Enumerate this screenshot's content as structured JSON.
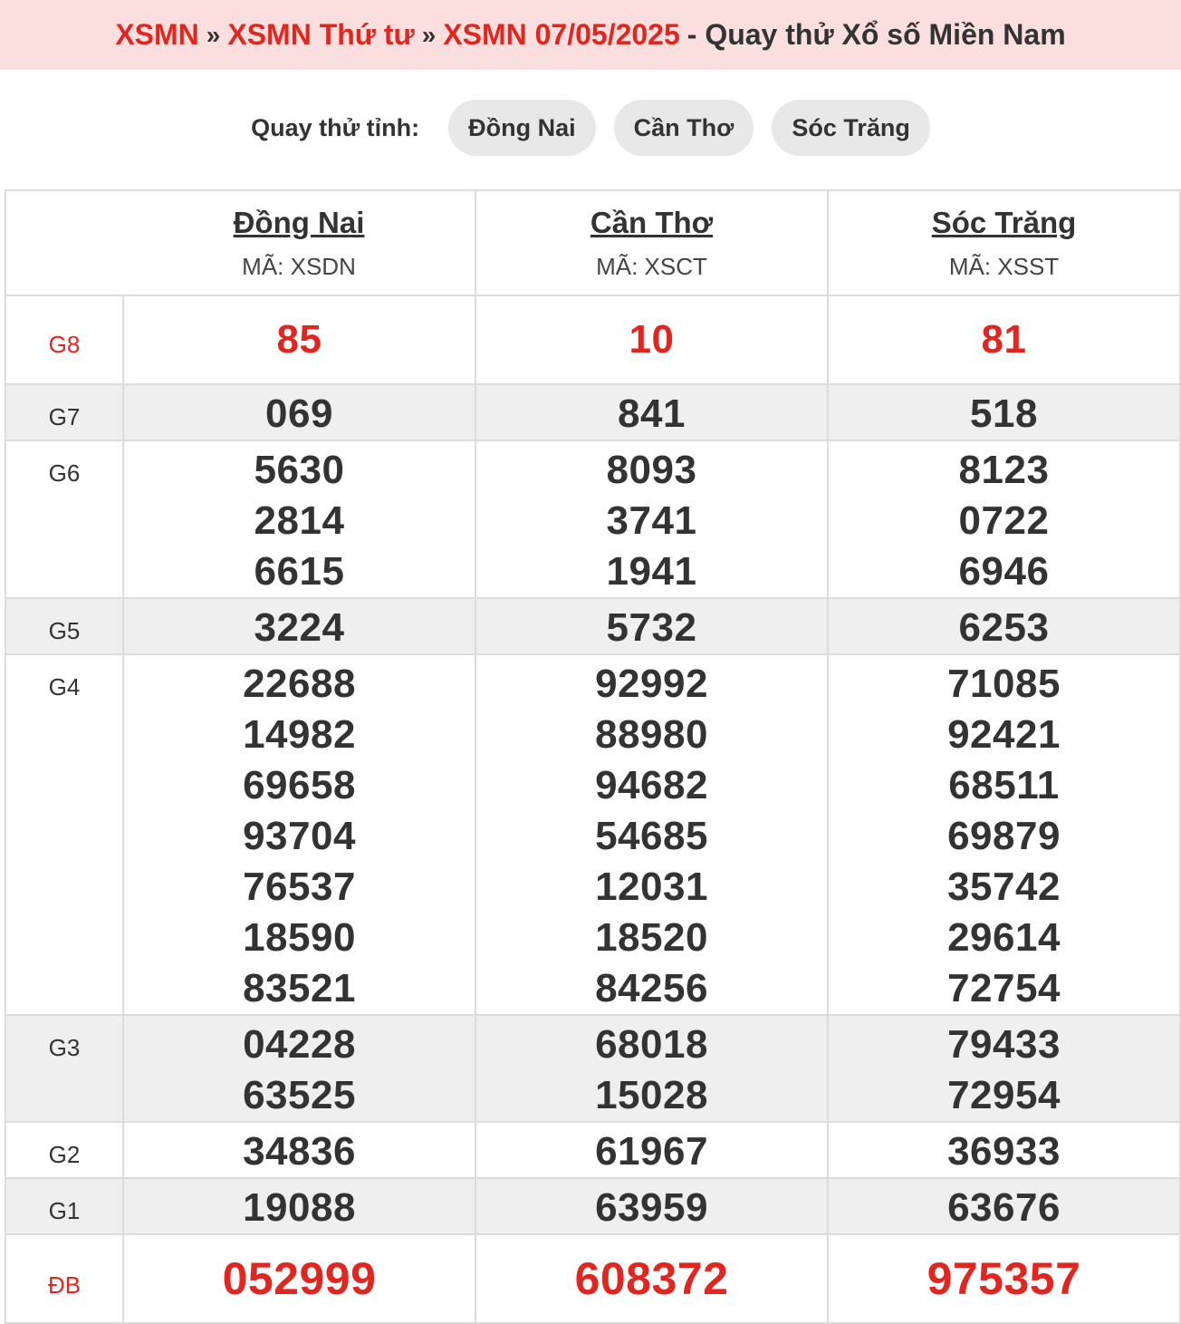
{
  "breadcrumb": {
    "items": [
      "XSMN",
      "XSMN Thứ tư",
      "XSMN 07/05/2025"
    ],
    "separator": "»",
    "suffix": "- Quay thử Xổ số Miền Nam"
  },
  "quick": {
    "label": "Quay thử tỉnh:",
    "provinces": [
      "Đồng Nai",
      "Cần Thơ",
      "Sóc Trăng"
    ]
  },
  "table": {
    "provinces": [
      {
        "name": "Đồng Nai",
        "code": "MÃ: XSDN"
      },
      {
        "name": "Cần Thơ",
        "code": "MÃ: XSCT"
      },
      {
        "name": "Sóc Trăng",
        "code": "MÃ: XSST"
      }
    ],
    "prizes": [
      {
        "label": "G8",
        "values": [
          [
            "85"
          ],
          [
            "10"
          ],
          [
            "81"
          ]
        ]
      },
      {
        "label": "G7",
        "values": [
          [
            "069"
          ],
          [
            "841"
          ],
          [
            "518"
          ]
        ]
      },
      {
        "label": "G6",
        "values": [
          [
            "5630",
            "2814",
            "6615"
          ],
          [
            "8093",
            "3741",
            "1941"
          ],
          [
            "8123",
            "0722",
            "6946"
          ]
        ]
      },
      {
        "label": "G5",
        "values": [
          [
            "3224"
          ],
          [
            "5732"
          ],
          [
            "6253"
          ]
        ]
      },
      {
        "label": "G4",
        "values": [
          [
            "22688",
            "14982",
            "69658",
            "93704",
            "76537",
            "18590",
            "83521"
          ],
          [
            "92992",
            "88980",
            "94682",
            "54685",
            "12031",
            "18520",
            "84256"
          ],
          [
            "71085",
            "92421",
            "68511",
            "69879",
            "35742",
            "29614",
            "72754"
          ]
        ]
      },
      {
        "label": "G3",
        "values": [
          [
            "04228",
            "63525"
          ],
          [
            "68018",
            "15028"
          ],
          [
            "79433",
            "72954"
          ]
        ]
      },
      {
        "label": "G2",
        "values": [
          [
            "34836"
          ],
          [
            "61967"
          ],
          [
            "36933"
          ]
        ]
      },
      {
        "label": "G1",
        "values": [
          [
            "19088"
          ],
          [
            "63959"
          ],
          [
            "63676"
          ]
        ]
      },
      {
        "label": "ĐB",
        "values": [
          [
            "052999"
          ],
          [
            "608372"
          ],
          [
            "975357"
          ]
        ]
      }
    ]
  },
  "colors": {
    "accent": "#e0261f",
    "header_bg": "#fbdede",
    "pill_bg": "#e8e8e8",
    "shade": "#efefef"
  }
}
